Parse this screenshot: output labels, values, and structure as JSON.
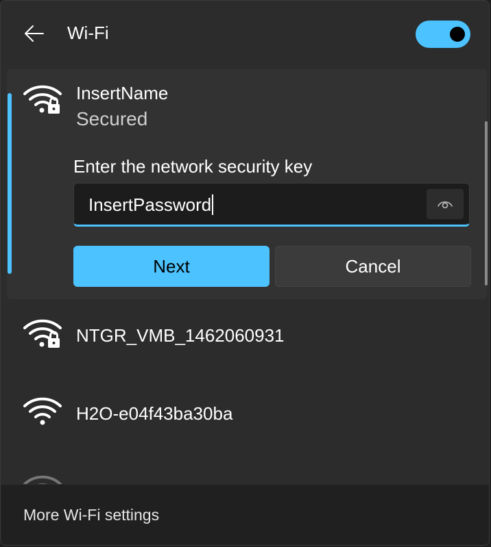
{
  "header": {
    "title": "Wi-Fi",
    "back_icon": "arrow-left-icon",
    "toggle_state": "on"
  },
  "connecting_network": {
    "name": "InsertName",
    "status": "Secured",
    "icon": "wifi-secured-icon",
    "key_label": "Enter the network security key",
    "password_value": "InsertPassword",
    "reveal_icon": "eye-icon",
    "next_label": "Next",
    "cancel_label": "Cancel"
  },
  "networks": [
    {
      "name": "NTGR_VMB_1462060931",
      "icon": "wifi-secured-icon"
    },
    {
      "name": "H2O-e04f43ba30ba",
      "icon": "wifi-icon"
    }
  ],
  "footer": {
    "link_label": "More Wi-Fi settings"
  },
  "colors": {
    "accent": "#4cc2ff",
    "panel": "#2c2c2c",
    "card": "#323232",
    "footer": "#202020"
  }
}
